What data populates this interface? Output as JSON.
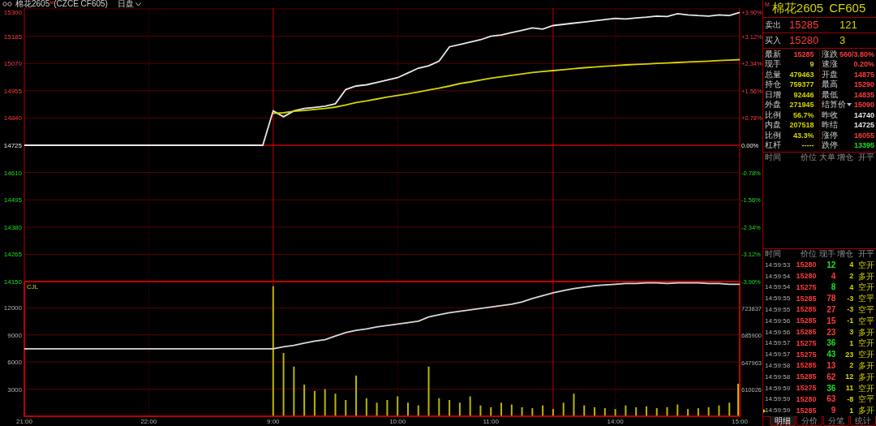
{
  "header": {
    "title": "棉花2605$^{M}$(CZCE CF605)",
    "session": "日盘"
  },
  "price_chart": {
    "chart_data": {
      "type": "line",
      "series": [
        {
          "color": "#e8e8e8",
          "values": [
            14725,
            14725,
            14725,
            14725,
            14725,
            14725,
            14725,
            14725,
            14725,
            14725,
            14725,
            14725,
            14725,
            14725,
            14725,
            14725,
            14725,
            14725,
            14725,
            14725,
            14725,
            14725,
            14725,
            14725,
            14870,
            14845,
            14870,
            14880,
            14885,
            14890,
            14900,
            14960,
            14975,
            14980,
            14990,
            15000,
            15010,
            15030,
            15050,
            15060,
            15080,
            15140,
            15150,
            15160,
            15170,
            15185,
            15190,
            15200,
            15210,
            15220,
            15215,
            15230,
            15235,
            15240,
            15245,
            15250,
            15255,
            15260,
            15258,
            15262,
            15265,
            15270,
            15268,
            15280,
            15275,
            15272,
            15270,
            15275,
            15272,
            15285
          ]
        },
        {
          "color": "#d4d400",
          "values": [
            null,
            null,
            null,
            null,
            null,
            null,
            null,
            null,
            null,
            null,
            null,
            null,
            null,
            null,
            null,
            null,
            null,
            null,
            null,
            null,
            null,
            null,
            null,
            null,
            14860,
            14862,
            14868,
            14872,
            14876,
            14880,
            14886,
            14895,
            14905,
            14912,
            14920,
            14928,
            14935,
            14942,
            14950,
            14958,
            14966,
            14975,
            14985,
            14992,
            15000,
            15008,
            15014,
            15020,
            15026,
            15032,
            15036,
            15040,
            15044,
            15048,
            15052,
            15055,
            15058,
            15061,
            15064,
            15066,
            15068,
            15070,
            15072,
            15074,
            15076,
            15078,
            15080,
            15082,
            15084,
            15086
          ]
        }
      ],
      "categories": [
        null,
        null,
        null,
        null,
        null,
        null,
        null,
        null,
        null,
        null,
        null,
        null,
        null,
        null,
        null,
        null,
        null,
        null,
        null,
        null,
        null,
        null,
        null,
        null,
        null,
        null,
        null,
        null,
        null,
        null,
        null,
        null,
        null,
        null,
        null,
        null,
        null,
        null,
        null,
        null,
        null,
        null,
        null,
        null,
        null,
        null,
        null,
        null,
        null,
        null,
        null,
        null,
        null,
        null,
        null,
        null,
        null,
        null,
        null,
        null,
        null,
        null,
        null,
        null,
        null,
        null,
        null,
        null,
        null,
        null
      ],
      "ylim": [
        14150,
        15300
      ],
      "yticks": [
        15300,
        15185,
        15070,
        14955,
        14840,
        14725,
        14610,
        14495,
        14380,
        14265,
        14150
      ]
    },
    "right_axis": [
      "+3.90%",
      "+3.12%",
      "+2.34%",
      "+1.56%",
      "+0.78%",
      "0.00%",
      "-0.78%",
      "-1.56%",
      "-2.34%",
      "-3.12%",
      "-3.90%"
    ]
  },
  "volume_chart": {
    "chart_data": {
      "type": "bar",
      "title": "CJL",
      "series": [
        {
          "color": "#b8b800",
          "values": [
            null,
            null,
            null,
            null,
            null,
            null,
            null,
            null,
            null,
            null,
            null,
            null,
            null,
            null,
            null,
            null,
            null,
            null,
            null,
            null,
            null,
            null,
            null,
            null,
            14400,
            7000,
            5500,
            3500,
            2800,
            3000,
            2500,
            1800,
            4500,
            2000,
            1500,
            1800,
            2200,
            1500,
            1200,
            5500,
            2000,
            1800,
            1500,
            2200,
            1200,
            1000,
            1500,
            1300,
            1000,
            900,
            1200,
            800,
            1500,
            2500,
            1200,
            1000,
            900,
            800,
            1200,
            1000,
            1100,
            900,
            1000,
            1300,
            800,
            900,
            1000,
            1200,
            1500,
            3600
          ]
        }
      ],
      "categories": [
        "21:00",
        null,
        null,
        null,
        null,
        null,
        null,
        null,
        null,
        null,
        null,
        null,
        "22:00",
        null,
        null,
        null,
        null,
        null,
        null,
        null,
        null,
        null,
        null,
        null,
        "9:00",
        null,
        null,
        null,
        null,
        null,
        null,
        null,
        null,
        null,
        null,
        null,
        "10:00",
        null,
        null,
        null,
        null,
        null,
        null,
        null,
        null,
        "11:00",
        null,
        null,
        null,
        null,
        null,
        null,
        null,
        null,
        null,
        null,
        null,
        "14:00",
        null,
        null,
        null,
        null,
        null,
        null,
        null,
        null,
        null,
        null,
        null,
        "15:00"
      ],
      "ylim": [
        0,
        14910
      ],
      "yticks": [
        3000,
        6000,
        9000,
        12000
      ]
    }
  },
  "open_interest_chart": {
    "chart_data": {
      "type": "line",
      "series": [
        {
          "color": "#d8d8d8",
          "values": [
            667000,
            667000,
            667000,
            667000,
            667000,
            667000,
            667000,
            667000,
            667000,
            667000,
            667000,
            667000,
            667000,
            667000,
            667000,
            667000,
            667000,
            667000,
            667000,
            667000,
            667000,
            667000,
            667000,
            667000,
            667000,
            670000,
            672000,
            675000,
            678000,
            680000,
            685000,
            690000,
            693000,
            695000,
            698000,
            700000,
            702000,
            704000,
            706000,
            712000,
            715000,
            718000,
            720000,
            722000,
            724000,
            726000,
            728000,
            730000,
            733000,
            738000,
            742000,
            746000,
            749000,
            752000,
            754000,
            756000,
            757000,
            758000,
            759000,
            759000,
            760000,
            760000,
            759000,
            760000,
            760000,
            760000,
            759000,
            759000,
            758000,
            758000
          ]
        }
      ],
      "categories": [
        null,
        null,
        null,
        null,
        null,
        null,
        null,
        null,
        null,
        null,
        null,
        null,
        null,
        null,
        null,
        null,
        null,
        null,
        null,
        null,
        null,
        null,
        null,
        null,
        null,
        null,
        null,
        null,
        null,
        null,
        null,
        null,
        null,
        null,
        null,
        null,
        null,
        null,
        null,
        null,
        null,
        null,
        null,
        null,
        null,
        null,
        null,
        null,
        null,
        null,
        null,
        null,
        null,
        null,
        null,
        null,
        null,
        null,
        null,
        null,
        null,
        null,
        null,
        null,
        null,
        null,
        null,
        null,
        null,
        null
      ],
      "ylim": [
        572089,
        761774
      ],
      "yticks": [
        610026,
        647963,
        685900,
        723837
      ]
    }
  },
  "quote": {
    "badge": "M",
    "name": "棉花2605",
    "code": "CF605",
    "ask": {
      "label": "卖出",
      "price": "15285",
      "volume": "121"
    },
    "bid": {
      "label": "买入",
      "price": "15280",
      "volume": "3"
    },
    "stats": [
      {
        "label": "最新",
        "value": "15285",
        "color": "#ff3b3b"
      },
      {
        "label": "涨跌",
        "value": "560/3.80%",
        "color": "#ff3b3b"
      },
      {
        "label": "现手",
        "value": "9",
        "color": "#d4d400"
      },
      {
        "label": "速涨",
        "value": "0.20%",
        "color": "#ff3b3b"
      },
      {
        "label": "总量",
        "value": "479463",
        "color": "#d4d400"
      },
      {
        "label": "开盘",
        "value": "14875",
        "color": "#ff3b3b"
      },
      {
        "label": "持仓",
        "value": "759377",
        "color": "#d4d400"
      },
      {
        "label": "最高",
        "value": "15290",
        "color": "#ff3b3b"
      },
      {
        "label": "日增",
        "value": "92446",
        "color": "#d4d400"
      },
      {
        "label": "最低",
        "value": "14835",
        "color": "#ff3b3b"
      },
      {
        "label": "外盘",
        "value": "271945",
        "color": "#d4d400"
      },
      {
        "label": "结算价",
        "value": "15090",
        "color": "#ff3b3b",
        "dropdown": true
      },
      {
        "label": "比例",
        "value": "56.7%",
        "color": "#d4d400"
      },
      {
        "label": "昨收",
        "value": "14740",
        "color": "#e8e8e8"
      },
      {
        "label": "内盘",
        "value": "207518",
        "color": "#d4d400"
      },
      {
        "label": "昨结",
        "value": "14725",
        "color": "#e8e8e8"
      },
      {
        "label": "比例",
        "value": "43.3%",
        "color": "#d4d400"
      },
      {
        "label": "涨停",
        "value": "16055",
        "color": "#ff3b3b"
      },
      {
        "label": "杠杆",
        "value": "-----",
        "color": "#d4d400"
      },
      {
        "label": "跌停",
        "value": "13395",
        "color": "#22dd22"
      }
    ]
  },
  "big_orders": {
    "columns": [
      "时间",
      "价位",
      "大单",
      "增仓",
      "开平"
    ]
  },
  "ticks": {
    "columns": [
      "时间",
      "价位",
      "现手",
      "增仓",
      "开平"
    ],
    "rows": [
      {
        "time": "14:59:53",
        "price": "15280",
        "volume": "12",
        "color": "#22dd22",
        "change": "4",
        "action": "空开",
        "current": false
      },
      {
        "time": "14:59:54",
        "price": "15280",
        "volume": "4",
        "color": "#ff3b3b",
        "change": "2",
        "action": "多开",
        "current": false
      },
      {
        "time": "14:59:54",
        "price": "15275",
        "volume": "8",
        "color": "#22dd22",
        "change": "4",
        "action": "空开",
        "current": false
      },
      {
        "time": "14:59:55",
        "price": "15285",
        "volume": "78",
        "color": "#ff3b3b",
        "change": "-3",
        "action": "空平",
        "current": false
      },
      {
        "time": "14:59:55",
        "price": "15285",
        "volume": "27",
        "color": "#ff3b3b",
        "change": "-3",
        "action": "空平",
        "current": false
      },
      {
        "time": "14:59:56",
        "price": "15285",
        "volume": "15",
        "color": "#ff3b3b",
        "change": "-1",
        "action": "空平",
        "current": false
      },
      {
        "time": "14:59:56",
        "price": "15285",
        "volume": "23",
        "color": "#ff3b3b",
        "change": "3",
        "action": "多开",
        "current": false
      },
      {
        "time": "14:59:57",
        "price": "15275",
        "volume": "36",
        "color": "#22dd22",
        "change": "1",
        "action": "空开",
        "current": false
      },
      {
        "time": "14:59:57",
        "price": "15275",
        "volume": "43",
        "color": "#22dd22",
        "change": "23",
        "action": "空开",
        "current": false
      },
      {
        "time": "14:59:58",
        "price": "15285",
        "volume": "13",
        "color": "#ff3b3b",
        "change": "2",
        "action": "多开",
        "current": false
      },
      {
        "time": "14:59:58",
        "price": "15285",
        "volume": "62",
        "color": "#ff3b3b",
        "change": "12",
        "action": "多开",
        "current": false
      },
      {
        "time": "14:59:59",
        "price": "15275",
        "volume": "36",
        "color": "#22dd22",
        "change": "11",
        "action": "空开",
        "current": false
      },
      {
        "time": "14:59:59",
        "price": "15280",
        "volume": "63",
        "color": "#ff3b3b",
        "change": "-8",
        "action": "空平",
        "current": false
      },
      {
        "time": "14:59:59",
        "price": "15285",
        "volume": "9",
        "color": "#ff3b3b",
        "change": "1",
        "action": "多开",
        "current": true
      }
    ]
  },
  "tabs": [
    {
      "label": "明细",
      "selected": true
    },
    {
      "label": "分价",
      "selected": false
    },
    {
      "label": "分笔",
      "selected": false
    },
    {
      "label": "统计",
      "selected": false
    }
  ]
}
